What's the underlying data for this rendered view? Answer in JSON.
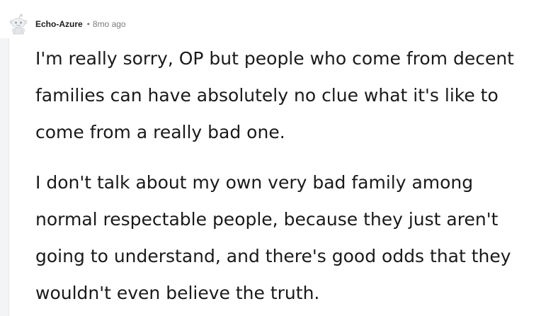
{
  "comment": {
    "username": "Echo-Azure",
    "separator": "•",
    "time_ago": "8mo ago",
    "paragraphs": [
      "I'm really sorry, OP but people who come from decent families can have absolutely no clue what it's like to come from a really bad one.",
      "I don't talk about my own very bad family among normal respectable people, because they just aren't going to understand, and there's good odds that they wouldn't even believe the truth."
    ]
  }
}
